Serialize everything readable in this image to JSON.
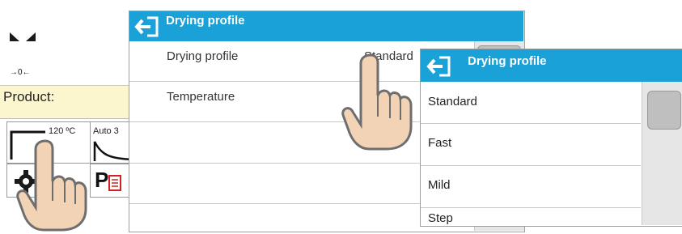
{
  "background_screen": {
    "zero_indicator": "→0←",
    "product_label": "Product:",
    "profile_tile": {
      "temperature": "120 ºC"
    },
    "mode_tile": {
      "label": "Auto 3"
    },
    "print_icon_letter": "P"
  },
  "dialog_main": {
    "title": "Drying profile",
    "rows": [
      {
        "label": "Drying profile",
        "value": "Standard"
      },
      {
        "label": "Temperature",
        "value": ""
      }
    ]
  },
  "dialog_dropdown": {
    "title": "Drying profile",
    "options": [
      "Standard",
      "Fast",
      "Mild",
      "Step"
    ]
  },
  "colors": {
    "header_blue": "#1aa1d8",
    "product_bar": "#fcf6cf",
    "scrollbar": "#e6e6e6"
  },
  "icons": [
    "stability-icon",
    "back-icon",
    "settings-gear-icon",
    "print-icon",
    "drying-profile-icon",
    "hand-pointer-icon"
  ]
}
